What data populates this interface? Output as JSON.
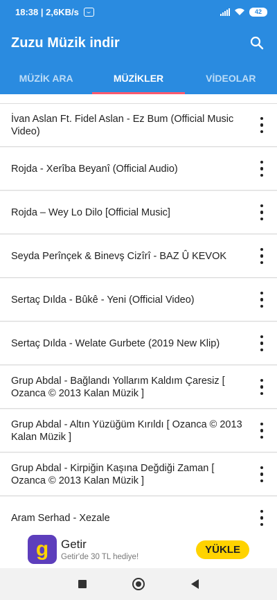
{
  "status_bar": {
    "time_speed": "18:38 | 2,6KB/s",
    "battery": "42"
  },
  "app_bar": {
    "title": "Zuzu Müzik indir",
    "search_icon": "search-icon"
  },
  "tabs": [
    {
      "label": "MÜZİK ARA"
    },
    {
      "label": "MÜZİKLER"
    },
    {
      "label": "VİDEOLAR"
    }
  ],
  "active_tab": "MÜZİKLER",
  "colors": {
    "primary": "#2a8be0",
    "tab_indicator": "#ff5a6e",
    "ad_brand": "#5d3ebc",
    "ad_button": "#ffd300"
  },
  "songs": [
    {
      "title": "İvan Aslan Ft. Fidel Aslan - Ez Bum (Official Music Video)"
    },
    {
      "title": "Rojda - Xerîba Beyanî (Official Audio)"
    },
    {
      "title": "Rojda – Wey Lo Dilo [Official Music]"
    },
    {
      "title": "Seyda Perînçek & Binevş Cizîrî - BAZ Û KEVOK"
    },
    {
      "title": "Sertaç Dılda - Bûkê - Yeni (Official Video)"
    },
    {
      "title": "Sertaç Dılda - Welate Gurbete (2019 New Klip)"
    },
    {
      "title": "Grup Abdal - Bağlandı Yollarım Kaldım Çaresiz [ Ozanca © 2013 Kalan Müzik ]"
    },
    {
      "title": "Grup Abdal - Altın Yüzüğüm Kırıldı [ Ozanca © 2013 Kalan Müzik ]"
    },
    {
      "title": "Grup Abdal - Kirpiğin Kaşına Değdiği Zaman [ Ozanca © 2013 Kalan Müzik ]"
    },
    {
      "title": "Aram Serhad - Xezale"
    }
  ],
  "ad": {
    "logo_letter": "g",
    "name": "Getir",
    "subtitle": "Getir'de 30 TL hediye!",
    "cta": "YÜKLE"
  }
}
